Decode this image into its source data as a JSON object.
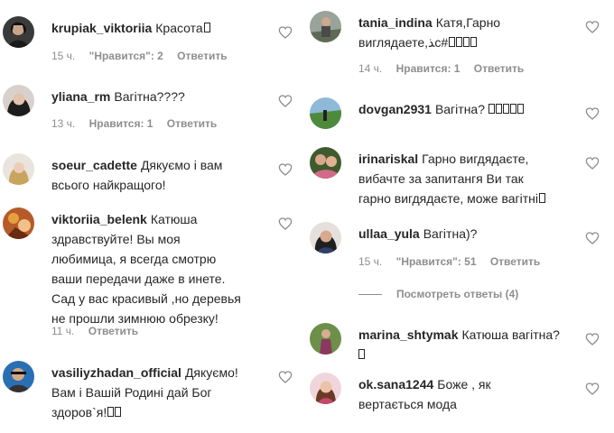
{
  "left_comments": [
    {
      "username": "krupiak_viktoriia",
      "text": "Красота",
      "time": "15 ч.",
      "likes": "\"Нравится\": 2",
      "reply": "Ответить"
    },
    {
      "username": "yliana_rm",
      "text": "Вагітна????",
      "time": "13 ч.",
      "likes": "Нравится: 1",
      "reply": "Ответить"
    },
    {
      "username": "soeur_cadette",
      "text": "Дякуємо і вам\nвсього найкращого!"
    },
    {
      "username": "viktoriia_belenk",
      "text": "Катюша\nздравствуйте! Вы моя\nлюбимица, я всегда смотрю\nваши передачи даже в инете.\nСад у вас красивый ,но деревья\nне прошли зимнюю обрезку!",
      "time": "11 ч.",
      "reply": "Ответить"
    },
    {
      "username": "vasiliyzhadan_official",
      "text": "Дякуємо!\nВам і Вашій Родині дай Бог\nздоров`я!"
    }
  ],
  "right_comments": [
    {
      "username": "tania_indina",
      "text": "Катя,Гарно\nвиглядаете,",
      "time": "14 ч.",
      "likes": "Нравится: 1",
      "reply": "Ответить"
    },
    {
      "username": "dovgan2931",
      "text": "Вагітна?"
    },
    {
      "username": "irinariskal",
      "text": "Гарно вигдядаєте,\nвибачте за запитангя Ви так\nгарно вигдядаєте, може вагітні"
    },
    {
      "username": "ullaa_yula",
      "text": "Вагітна)?",
      "time": "15 ч.",
      "likes": "\"Нравится\": 51",
      "reply": "Ответить"
    },
    {
      "username": "marina_shtymak",
      "text": "Катюша вагітна?"
    },
    {
      "username": "ok.sana1244",
      "text": "Боже , як\nвертається мода"
    }
  ],
  "view_replies": "Посмотреть ответы (4)",
  "colors": {
    "text": "#262626",
    "meta": "#8e8e8e",
    "heart_stroke": "#8e8e8e"
  },
  "icons": {
    "like": "heart-outline-icon"
  }
}
